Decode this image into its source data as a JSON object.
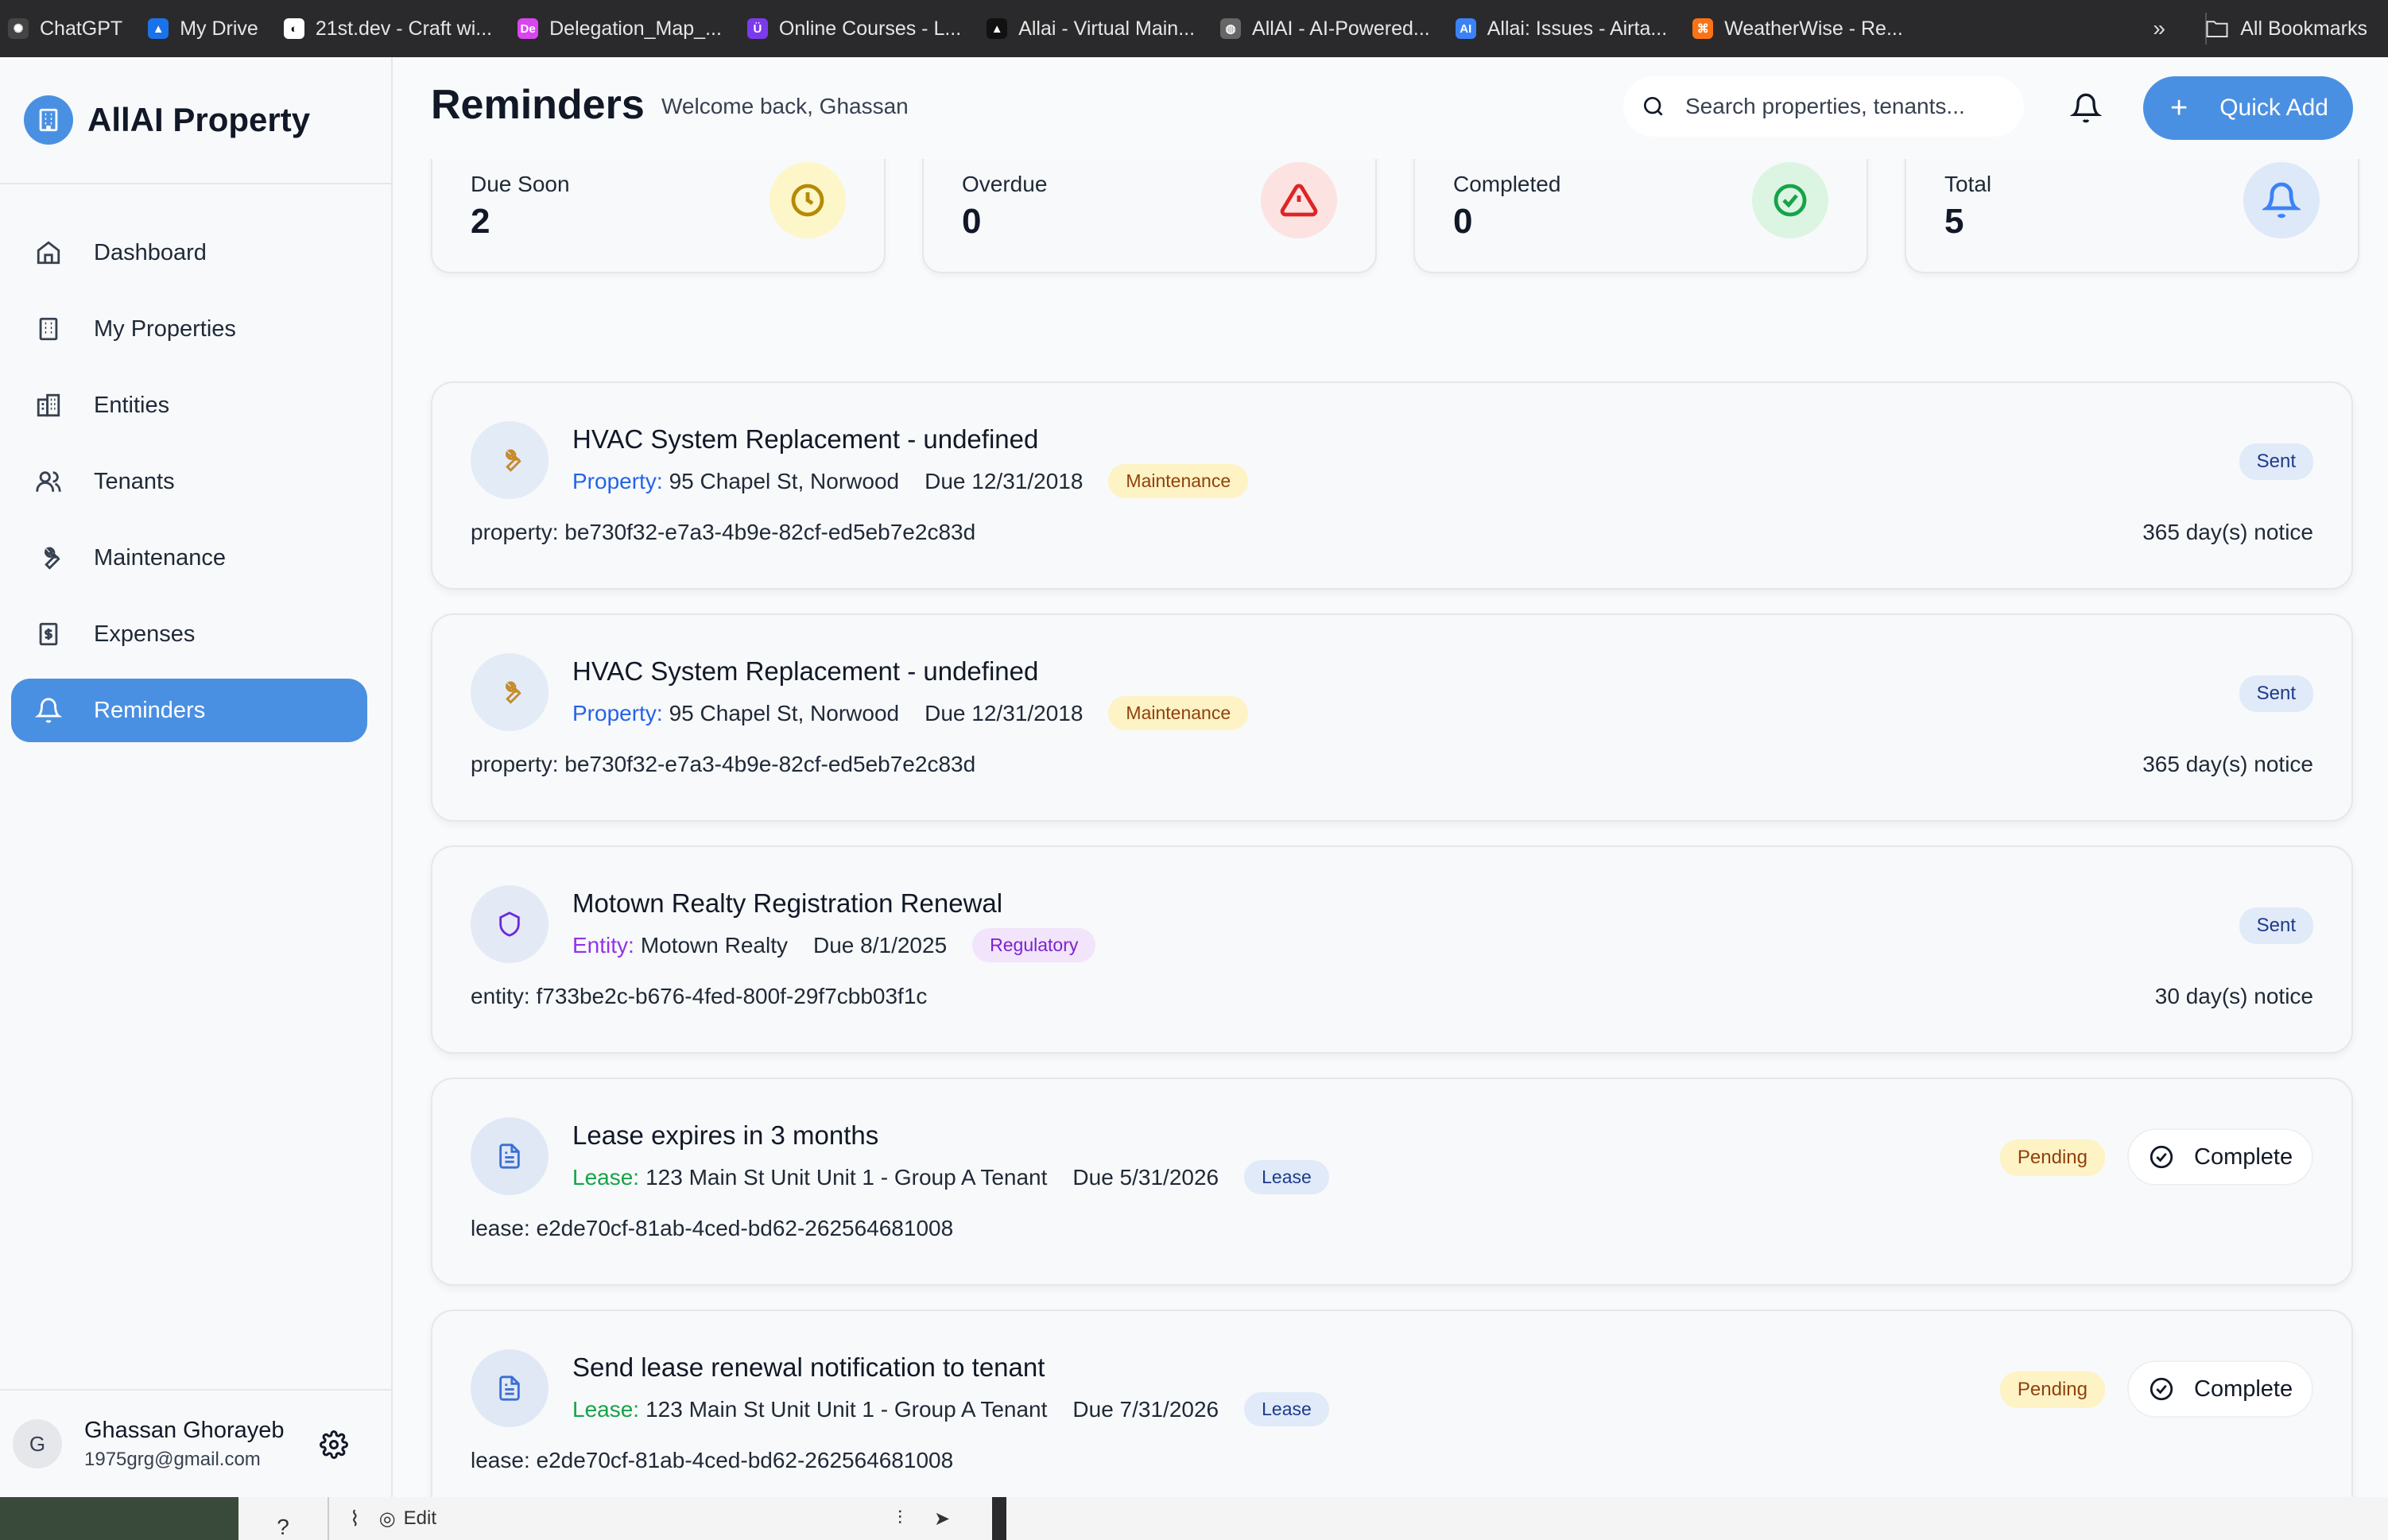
{
  "bookmarks": [
    {
      "label": "ChatGPT",
      "color": "#444444",
      "glyph": "✺"
    },
    {
      "label": "My Drive",
      "color": "#1a73e8",
      "glyph": "▲"
    },
    {
      "label": "21st.dev - Craft wi...",
      "color": "#ffffff",
      "glyph": "◐"
    },
    {
      "label": "Delegation_Map_...",
      "color": "#d946ef",
      "glyph": "De"
    },
    {
      "label": "Online Courses - L...",
      "color": "#7c3aed",
      "glyph": "Ü"
    },
    {
      "label": "Allai - Virtual Main...",
      "color": "#111111",
      "glyph": "▲"
    },
    {
      "label": "AllAI - AI-Powered...",
      "color": "#666666",
      "glyph": "◍"
    },
    {
      "label": "Allai: Issues - Airta...",
      "color": "#3b82f6",
      "glyph": "AI"
    },
    {
      "label": "WeatherWise - Re...",
      "color": "#f97316",
      "glyph": "⌘"
    }
  ],
  "bookmarks_more": "»",
  "all_bookmarks": "All Bookmarks",
  "brand": {
    "name": "AllAI Property"
  },
  "nav": [
    {
      "label": "Dashboard",
      "icon": "home-icon"
    },
    {
      "label": "My Properties",
      "icon": "building-icon"
    },
    {
      "label": "Entities",
      "icon": "entities-icon"
    },
    {
      "label": "Tenants",
      "icon": "users-icon"
    },
    {
      "label": "Maintenance",
      "icon": "wrench-icon"
    },
    {
      "label": "Expenses",
      "icon": "receipt-icon"
    },
    {
      "label": "Reminders",
      "icon": "bell-icon",
      "active": true
    }
  ],
  "user": {
    "initial": "G",
    "name": "Ghassan Ghorayeb",
    "email": "1975grg@gmail.com"
  },
  "header": {
    "title": "Reminders",
    "welcome": "Welcome back, Ghassan",
    "search_placeholder": "Search properties, tenants...",
    "quick_add": "Quick Add"
  },
  "stats": [
    {
      "label": "Due Soon",
      "value": "2",
      "icon": "clock-icon",
      "bg": "#fdf6c8",
      "fg": "#b58a06"
    },
    {
      "label": "Overdue",
      "value": "0",
      "icon": "alert-triangle-icon",
      "bg": "#fde2e2",
      "fg": "#dc2626"
    },
    {
      "label": "Completed",
      "value": "0",
      "icon": "check-circle-icon",
      "bg": "#dcf5e3",
      "fg": "#16a34a"
    },
    {
      "label": "Total",
      "value": "5",
      "icon": "bell-icon",
      "bg": "#dde8f8",
      "fg": "#3b82f6"
    }
  ],
  "reminders": [
    {
      "title": "HVAC System Replacement - undefined",
      "link_label": "Property:",
      "link_value": "95 Chapel St, Norwood",
      "due": "Due 12/31/2018",
      "tag": "Maintenance",
      "id_text": "property: be730f32-e7a3-4b9e-82cf-ed5eb7e2c83d",
      "notice": "365 day(s) notice",
      "status": "Sent",
      "icon": "wrench-icon",
      "kind": "maintenance"
    },
    {
      "title": "HVAC System Replacement - undefined",
      "link_label": "Property:",
      "link_value": "95 Chapel St, Norwood",
      "due": "Due 12/31/2018",
      "tag": "Maintenance",
      "id_text": "property: be730f32-e7a3-4b9e-82cf-ed5eb7e2c83d",
      "notice": "365 day(s) notice",
      "status": "Sent",
      "icon": "wrench-icon",
      "kind": "maintenance"
    },
    {
      "title": "Motown Realty Registration Renewal",
      "link_label": "Entity:",
      "link_value": "Motown Realty",
      "due": "Due 8/1/2025",
      "tag": "Regulatory",
      "id_text": "entity: f733be2c-b676-4fed-800f-29f7cbb03f1c",
      "notice": "30 day(s) notice",
      "status": "Sent",
      "icon": "shield-icon",
      "kind": "regulatory"
    },
    {
      "title": "Lease expires in 3 months",
      "link_label": "Lease:",
      "link_value": "123 Main St Unit Unit 1 - Group A Tenant",
      "due": "Due 5/31/2026",
      "tag": "Lease",
      "id_text": "lease: e2de70cf-81ab-4ced-bd62-262564681008",
      "notice": "",
      "status": "Pending",
      "action": "Complete",
      "icon": "document-icon",
      "kind": "lease"
    },
    {
      "title": "Send lease renewal notification to tenant",
      "link_label": "Lease:",
      "link_value": "123 Main St Unit Unit 1 - Group A Tenant",
      "due": "Due 7/31/2026",
      "tag": "Lease",
      "id_text": "lease: e2de70cf-81ab-4ced-bd62-262564681008",
      "notice": "",
      "status": "Pending",
      "action": "Complete",
      "icon": "document-icon",
      "kind": "lease"
    }
  ],
  "taskbar": {
    "composer_edit": "Edit",
    "help": "?"
  },
  "colors": {
    "accent": "#4a90e2",
    "maintenance_tag_bg": "#fdf3c4",
    "maintenance_tag_fg": "#92400e",
    "regulatory_tag_bg": "#f1e4fb",
    "regulatory_tag_fg": "#7e22ce",
    "lease_tag_bg": "#e0eaf8",
    "lease_tag_fg": "#1e3a8a",
    "property_link": "#2563eb",
    "entity_link": "#9333ea",
    "lease_link": "#16a34a"
  }
}
